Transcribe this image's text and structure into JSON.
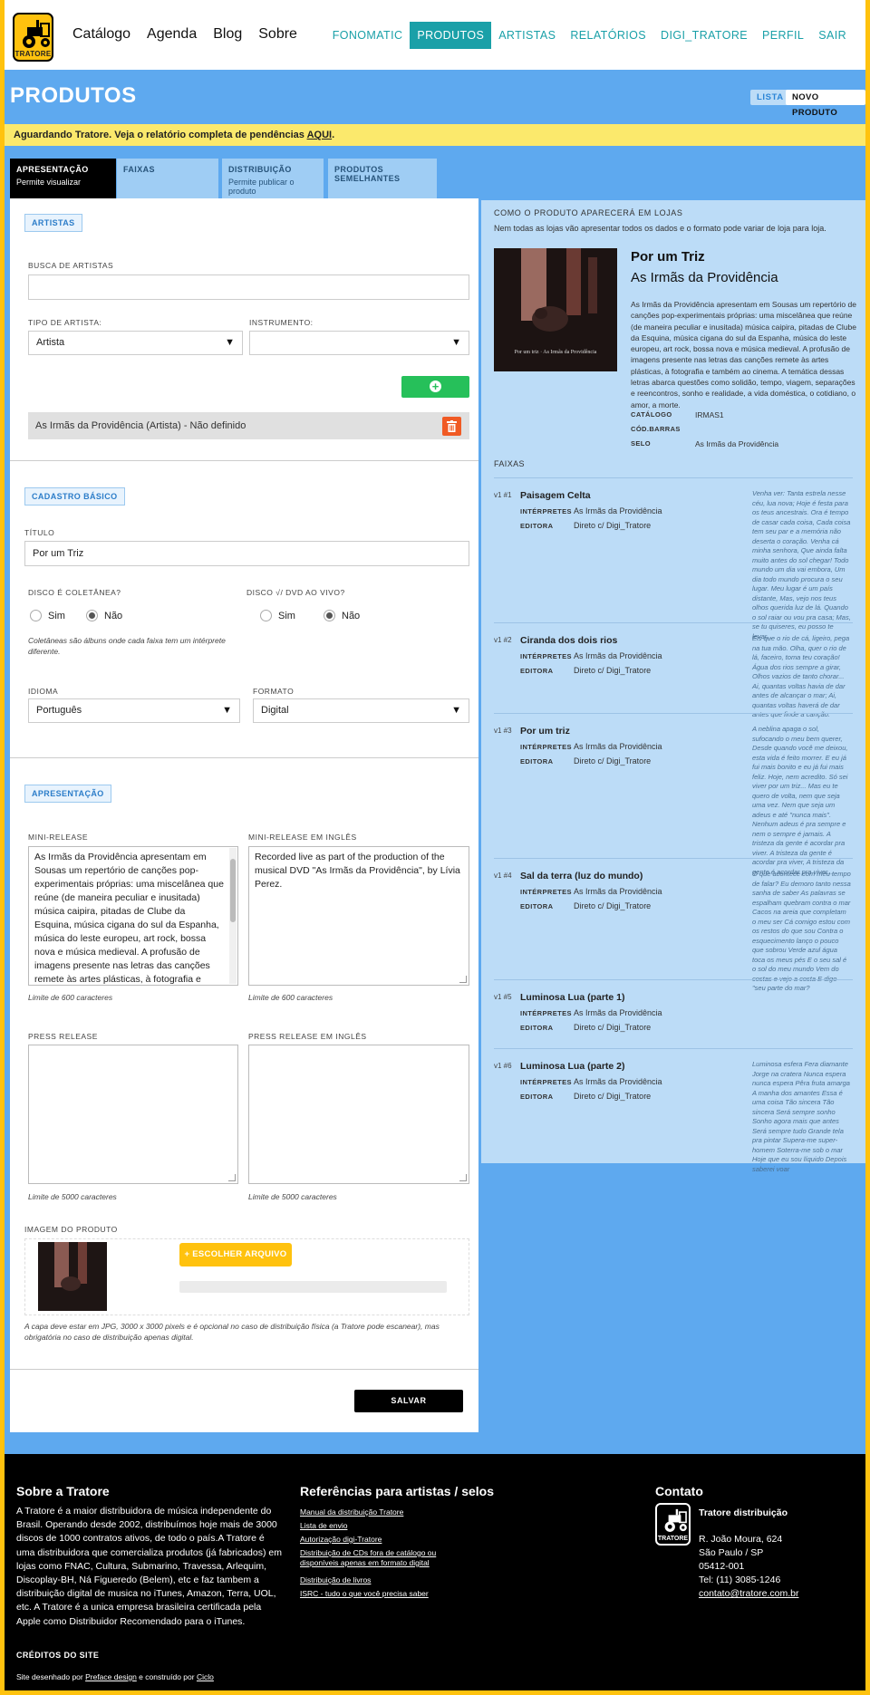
{
  "header": {
    "logo_text": "TRATORE",
    "nav": [
      "Catálogo",
      "Agenda",
      "Blog",
      "Sobre"
    ],
    "right_nav": [
      "FONOMATIC",
      "PRODUTOS",
      "ARTISTAS",
      "RELATÓRIOS",
      "DIGI_TRATORE",
      "PERFIL",
      "SAIR"
    ],
    "active_right_nav": "PRODUTOS"
  },
  "page": {
    "title": "PRODUTOS",
    "btn_lista": "LISTA",
    "btn_novo": "NOVO PRODUTO",
    "notice_text": "Aguardando Tratore. Veja o relatório completa de pendências ",
    "notice_link": "AQUI",
    "notice_end": "."
  },
  "tabs": [
    {
      "title": "APRESENTAÇÃO",
      "subtitle": "Permite visualizar"
    },
    {
      "title": "FAIXAS",
      "subtitle": ""
    },
    {
      "title": "DISTRIBUIÇÃO",
      "subtitle": "Permite publicar o produto"
    },
    {
      "title": "PRODUTOS SEMELHANTES",
      "subtitle": ""
    }
  ],
  "form": {
    "artistas": {
      "tag": "ARTISTAS",
      "busca_label": "BUSCA DE ARTISTAS",
      "busca_value": "",
      "tipo_label": "TIPO DE ARTISTA:",
      "tipo_value": "Artista",
      "instrumento_label": "INSTRUMENTO:",
      "instrumento_value": "",
      "artist_row": "As Irmãs da Providência (Artista) - Não definido"
    },
    "cadastro": {
      "tag": "CADASTRO BÁSICO",
      "titulo_label": "TÍTULO",
      "titulo_value": "Por um Triz",
      "disco_label": "DISCO É COLETÂNEA?",
      "dvd_label": "DISCO √/ DVD AO VIVO?",
      "sim": "Sim",
      "nao": "Não",
      "hint": "Coletâneas são álbuns onde cada faixa tem um intérprete diferente.",
      "idioma_label": "IDIOMA",
      "idioma_value": "Português",
      "formato_label": "FORMATO",
      "formato_value": "Digital"
    },
    "apresentacao": {
      "tag": "APRESENTAÇÃO",
      "mini_label": "MINI-RELEASE",
      "mini_value": "As Irmãs da Providência apresentam em Sousas um repertório de canções pop-experimentais próprias: uma miscelânea que reúne (de maneira peculiar e inusitada) música caipira, pitadas de Clube da Esquina, música cigana do sul da Espanha, música do leste europeu, art rock, bossa nova e música medieval. A profusão de imagens presente nas letras das canções remete às artes plásticas, à fotografia e também ao cinema. A temática",
      "mini_en_label": "MINI-RELEASE EM INGLÊS",
      "mini_en_value": "Recorded live as part of the production of the musical DVD \"As Irmãs da Providência\", by Lívia Perez.",
      "limit_600": "Limite de 600 caracteres",
      "press_label": "PRESS RELEASE",
      "press_en_label": "PRESS RELEASE EM INGLÊS",
      "limit_5000": "Limite de 5000 caracteres",
      "imagem_label": "IMAGEM DO PRODUTO",
      "btn_file": "+ ESCOLHER ARQUIVO",
      "image_hint": "A capa deve estar em JPG, 3000 x 3000 pixels e é opcional no caso de distribuição física (a Tratore pode escanear), mas obrigatória no caso de distribuição apenas digital."
    },
    "save": "SALVAR"
  },
  "preview": {
    "heading": "COMO O PRODUTO APARECERÁ EM LOJAS",
    "sub": "Nem todas as lojas vão apresentar todos os dados e o formato pode variar de loja para loja.",
    "cover_caption": "Por um triz · As Irmãs da Providência",
    "title": "Por um Triz",
    "artist": "As Irmãs da Providência",
    "description": "As Irmãs da Providência apresentam em Sousas um repertório de canções pop-experimentais próprias: uma miscelânea que reúne (de maneira peculiar e inusitada) música caipira, pitadas de Clube da Esquina, música cigana do sul da Espanha, música do leste europeu, art rock, bossa nova e música medieval. A profusão de imagens presente nas letras das canções remete às artes plásticas, à fotografia e também ao cinema. A temática dessas letras abarca questões como solidão, tempo, viagem, separações e reencontros, sonho e realidade, a vida doméstica, o cotidiano, o amor, a morte.",
    "meta": [
      {
        "k": "CATÁLOGO",
        "v": "IRMAS1"
      },
      {
        "k": "CÓD.BARRAS",
        "v": ""
      },
      {
        "k": "SELO",
        "v": "As Irmãs da Providência"
      }
    ],
    "faixas_heading": "FAIXAS",
    "interpretes_label": "INTÉRPRETES",
    "editora_label": "EDITORA",
    "tracks": [
      {
        "num": "v1 #1",
        "name": "Paisagem Celta",
        "interpretes": "As Irmãs da Providência",
        "editora": "Direto c/ Digi_Tratore",
        "lyrics": "Venha ver: Tanta estrela nesse céu, lua nova; Hoje é festa para os teus ancestrais. Ora é tempo de casar cada coisa, Cada coisa tem seu par e a memória não deserta o coração. Venha cá minha senhora, Que ainda falta muito antes do sol chegar! Todo mundo um dia vai embora, Um dia todo mundo procura o seu lugar. Meu lugar é um país distante, Mas, vejo nos teus olhos querida luz de lá. Quando o sol raiar ou vou pra casa; Mas, se tu quiseres, eu posso te levar..."
      },
      {
        "num": "v1 #2",
        "name": "Ciranda dos dois rios",
        "interpretes": "As Irmãs da Providência",
        "editora": "Direto c/ Digi_Tratore",
        "lyrics": "Eis que o rio de cá, ligeiro, pega na tua mão. Olha, quer o rio de lá, faceiro, toma teu coração! Água dos rios sempre a girar, Olhos vazios de tanto chorar... Ai, quantas voltas havia de dar antes de alcançar o mar; Ai, quantas voltas haverá de dar antes que finde a canção."
      },
      {
        "num": "v1 #3",
        "name": "Por um triz",
        "interpretes": "As Irmãs da Providência",
        "editora": "Direto c/ Digi_Tratore",
        "lyrics": "A neblina apaga o sol, sufocando o meu bem querer, Desde quando você me deixou, esta vida é feito morrer. E eu já fui mais bonito e eu já fui mais feliz. Hoje, nem acredito. Só sei viver por um triz... Mas eu te quero de volta, nem que seja uma vez. Nem que seja um adeus e até \"nunca mais\". Nenhum adeus é pra sempre e nem o sempre é jamais. A tristeza da gente é acordar pra viver. A tristeza da gente é acordar pra viver, A tristeza da gente é acordar pra viver..."
      },
      {
        "num": "v1 #4",
        "name": "Sal da terra (luz do mundo)",
        "interpretes": "As Irmãs da Providência",
        "editora": "Direto c/ Digi_Tratore",
        "lyrics": "O que acontece com meu tempo de falar? Eu demoro tanto nessa sanha de saber As palavras se espalham quebram contra o mar Cacos na areia que completam o meu ser Cá comigo estou com os restos do que sou Contra o esquecimento lanço o pouco que sobrou Verde azul água toca os meus pés E o seu sal é o sol do meu mundo Vem do costas e vejo a costa E digo \"seu parte do mar?"
      },
      {
        "num": "v1 #5",
        "name": "Luminosa Lua (parte 1)",
        "interpretes": "As Irmãs da Providência",
        "editora": "Direto c/ Digi_Tratore",
        "lyrics": ""
      },
      {
        "num": "v1 #6",
        "name": "Luminosa Lua (parte 2)",
        "interpretes": "As Irmãs da Providência",
        "editora": "Direto c/ Digi_Tratore",
        "lyrics": "Luminosa esfera Fera diamante Jorge na cratera Nunca espera nunca espera Pêra fruta amarga A manha dos amantes Essa é uma coisa Tão sincera Tão sincera Será sempre sonho Sonho agora mais que antes Será sempre tudo Grande tela pra pintar Supera-me super-homem Soterra-me sob o mar Hoje que eu sou líquido Depois saberei voar"
      }
    ]
  },
  "footer": {
    "about_title": "Sobre a Tratore",
    "about_text": "A Tratore é a maior distribuidora de música independente do Brasil. Operando desde 2002, distribuímos hoje mais de 3000 discos de 1000 contratos ativos, de todo o país.A Tratore é uma distribuidora que comercializa produtos (já fabricados) em lojas como FNAC, Cultura, Submarino, Travessa, Arlequim, Discoplay-BH, Ná Figueredo (Belem), etc e faz tambem a distribuição digital de musica no iTunes, Amazon, Terra, UOL, etc. A Tratore é a unica empresa brasileira certificada pela Apple como Distribuidor Recomendado para o iTunes.",
    "refs_title": "Referências para artistas / selos",
    "links": [
      "Manual da distribuição Tratore",
      "Lista de envio",
      "Autorização digi-Tratore",
      "Distribuição de CDs fora de catálogo ou disponíveis apenas em formato digital",
      "Distribuição de livros",
      "ISRC - tudo o que você precisa saber"
    ],
    "contact_title": "Contato",
    "logo_text": "TRATORE",
    "contact": {
      "name": "Tratore distribuição",
      "address": "R. João Moura, 624",
      "city": "São Paulo / SP",
      "zip": "05412-001",
      "phone": "Tel: (11) 3085-1246",
      "email": "contato@tratore.com.br"
    },
    "credits_title": "CRÉDITOS DO SITE",
    "credit_prefix": "Site desenhado por ",
    "credit_designer": "Preface design",
    "credit_mid": " e construído por ",
    "credit_builder": "Ciclo"
  }
}
